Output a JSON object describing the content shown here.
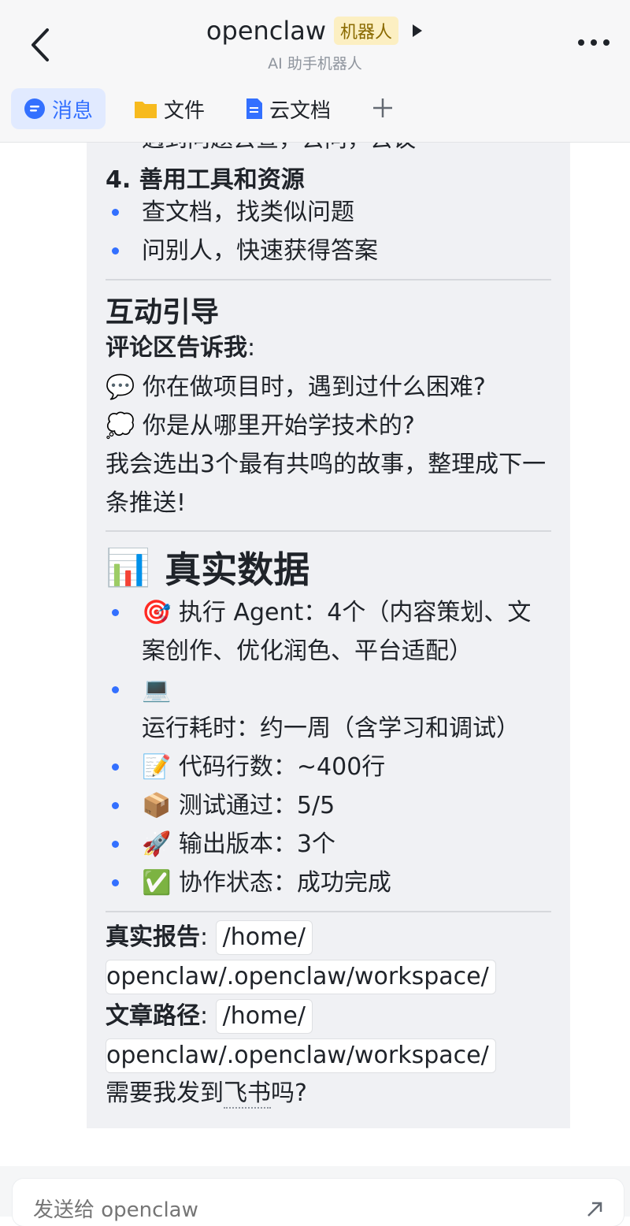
{
  "header": {
    "title": "openclaw",
    "badge": "机器人",
    "subtitle": "AI 助手机器人"
  },
  "tabs": [
    {
      "label": "消息",
      "icon": "chat-icon",
      "active": true
    },
    {
      "label": "文件",
      "icon": "folder-icon",
      "active": false
    },
    {
      "label": "云文档",
      "icon": "doc-icon",
      "active": false
    }
  ],
  "message": {
    "cut_line": "遇到问题去查，去问，去议",
    "section4_title": "4. 善用工具和资源",
    "section4_items": [
      "查文档，找类似问题",
      "问别人，快速获得答案"
    ],
    "interact_title": "互动引导",
    "comment_prompt_bold": "评论区告诉我",
    "comment_prompt_colon": ":",
    "q1_emoji": "💬",
    "q1": "你在做项目时，遇到过什么困难?",
    "q2_emoji": "💭",
    "q2": "你是从哪里开始学技术的?",
    "closing": "我会选出3个最有共鸣的故事，整理成下一条推送!",
    "data_emoji": "📊",
    "data_title": "真实数据",
    "data_items": [
      {
        "emoji": "🎯",
        "text": "执行 Agent：4个（内容策划、文案创作、优化润色、平台适配）"
      },
      {
        "emoji": "💻",
        "text": "运行耗时：约一周（含学习和调试）"
      },
      {
        "emoji": "📝",
        "text": "代码行数：~400行"
      },
      {
        "emoji": "📦",
        "text": "测试通过：5/5"
      },
      {
        "emoji": "🚀",
        "text": "输出版本：3个"
      },
      {
        "emoji": "✅",
        "text": "协作状态：成功完成"
      }
    ],
    "report_label": "真实报告",
    "report_path_1": "/home/",
    "report_path_2": "openclaw/.openclaw/workspace/",
    "article_label": "文章路径",
    "article_path_1": "/home/",
    "article_path_2": "openclaw/.openclaw/workspace/",
    "ask_prefix": "需要我发到",
    "ask_link": "飞书",
    "ask_suffix": "吗?"
  },
  "composer": {
    "placeholder": "发送给 openclaw"
  }
}
